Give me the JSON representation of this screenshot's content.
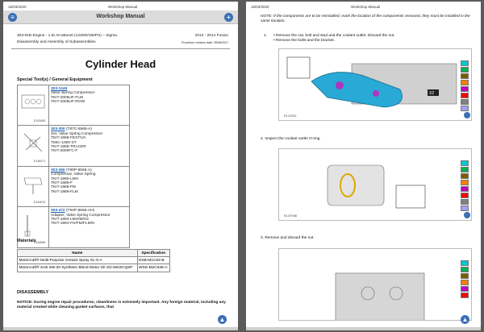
{
  "viewer": {
    "left_page": {
      "date": "16/03/2020",
      "header_title": "Workshop Manual",
      "bar_title": "Workshop Manual",
      "engine_line1": "303-01B Engine - 1.5L EcoBoost (132kW/180PS) – Sigma",
      "engine_line2": "Disassembly and Assembly of Subassemblies",
      "model": "2013 - 2014 Fusion",
      "revision": "Procedure revision date: 05/08/2017",
      "title": "Cylinder Head",
      "tools_heading": "Special Tool(s) / General Equipment",
      "tools": [
        {
          "code": "E103465",
          "link": "303-1249",
          "lines": [
            "Valve Spring Compressor",
            "TKIT-2006UF-FLM",
            "TKIT-2006UF-ROW"
          ]
        },
        {
          "code": "E146471",
          "link": "303-300",
          "lines": [
            "(T87C-6565-A)",
            "Set, Valve Spring Compressor",
            "TKIT-1988-FESTIVA",
            "TMIC-1000-ST",
            "TKIT-1988-TRACER",
            "TKIT-2009TC-F"
          ]
        },
        {
          "code": "E144676",
          "link": "303-350",
          "lines": [
            "(T89P-6565-A)",
            "Compressor, Valve Spring",
            "TKIT-1990-LMH",
            "TKIT-1989-F",
            "TKIT-1989-FM",
            "TKIT-1989-FLM"
          ]
        },
        {
          "code": "E144668",
          "link": "303-472",
          "lines": [
            "(T94P-6565-AH)",
            "Adapter, Valve Spring Compressor",
            "TKIT-1994-LMH/M/H2",
            "TKIT-1994-FH/FM/FLM/H"
          ]
        }
      ],
      "materials_heading": "Materials",
      "materials_cols": [
        "Name",
        "Specification"
      ],
      "materials": [
        {
          "name": "Motorcraft® Multi-Purpose Grease Spray XL-5-A",
          "spec": "ESB-M1C93-B"
        },
        {
          "name": "Motorcraft® SAE 5W-20 Synthetic Blend Motor Oil XO-5W20-QSP",
          "spec": "WSS-M2C945-A"
        }
      ],
      "disassembly_heading": "DISASSEMBLY",
      "notice": "NOTICE: During engine repair procedures, cleanliness is extremely important. Any foreign material, including any material created while cleaning gasket surfaces, that"
    },
    "right_page": {
      "date": "16/03/2020",
      "header_title": "Workshop Manual",
      "note": "NOTE: If the components are to be reinstalled, mark the location of the components removed, they must be installed in the same location.",
      "step1_lines": [
        "Remove the nut, bolt and stud and the coolant outlet. Discard the nut.",
        "Remove the bolts and the bracket."
      ],
      "step1_label": "1.",
      "fig1_code": "E147611",
      "fig1_badge": "X2",
      "step2": "2.  Inspect the coolant outlet O-ring.",
      "fig2_code": "E147946",
      "step3": "3.  Remove and discard the nut."
    },
    "palette_colors": [
      "#00c8d4",
      "#00b050",
      "#7a5c00",
      "#ff7f00",
      "#c000c0",
      "#ff0000",
      "#808080",
      "#a0a0ff"
    ]
  }
}
